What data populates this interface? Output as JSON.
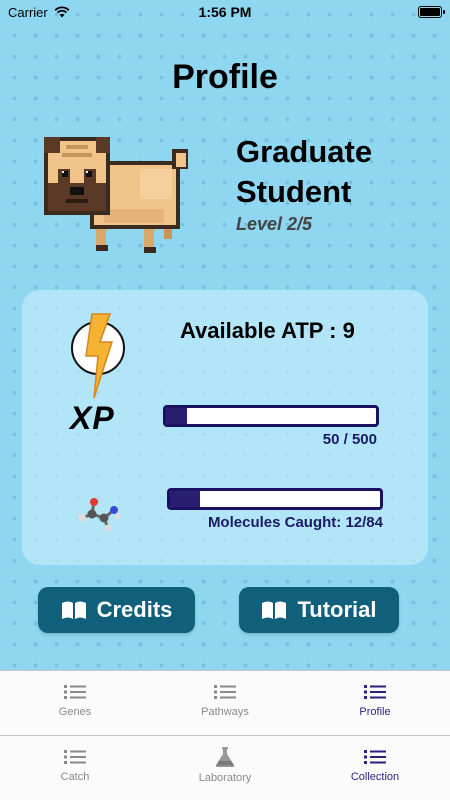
{
  "status_bar": {
    "carrier": "Carrier",
    "time": "1:56 PM"
  },
  "page": {
    "title": "Profile"
  },
  "profile": {
    "rank_title": "Graduate Student",
    "level": "Level 2/5",
    "avatar_icon": "pug-icon"
  },
  "stats": {
    "atp_label": "Available ATP : 9",
    "xp_label": "XP",
    "xp_value": "50 / 500",
    "xp_progress": 0.1,
    "molecules_value": "Molecules Caught: 12/84",
    "molecules_progress": 0.1429
  },
  "buttons": {
    "credits": "Credits",
    "tutorial": "Tutorial"
  },
  "tabs_top": [
    {
      "label": "Genes",
      "icon": "list-icon",
      "active": false
    },
    {
      "label": "Pathways",
      "icon": "list-icon",
      "active": false
    },
    {
      "label": "Profile",
      "icon": "list-icon",
      "active": true
    }
  ],
  "tabs_bottom": [
    {
      "label": "Catch",
      "icon": "list-icon",
      "active": false
    },
    {
      "label": "Laboratory",
      "icon": "flask-icon",
      "active": false
    },
    {
      "label": "Collection",
      "icon": "list-icon",
      "active": true
    }
  ],
  "colors": {
    "background": "#8fd7f0",
    "button": "#10607c",
    "accent": "#2b1f80",
    "progress_fill": "#2a1e72"
  }
}
